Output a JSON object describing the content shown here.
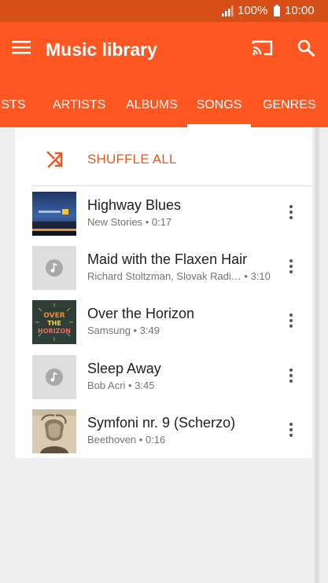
{
  "status_bar": {
    "battery_percent": "100%",
    "time": "10:00",
    "icons": [
      "signal-icon",
      "battery-icon"
    ]
  },
  "app_bar": {
    "title": "Music library",
    "icons": [
      "menu-icon",
      "cast-icon",
      "search-icon"
    ],
    "color": "#ff5722"
  },
  "tabs": [
    {
      "label": "PLAYLISTS",
      "visible": "LISTS",
      "active": false
    },
    {
      "label": "ARTISTS",
      "active": false
    },
    {
      "label": "ALBUMS",
      "active": false
    },
    {
      "label": "SONGS",
      "active": true
    },
    {
      "label": "GENRES",
      "active": false
    }
  ],
  "shuffle": {
    "label": "SHUFFLE ALL",
    "icon": "shuffle-icon",
    "color": "#e45a22"
  },
  "songs": [
    {
      "title": "Highway Blues",
      "artist": "New Stories",
      "duration": "0:17",
      "art": "highway-blues-cover"
    },
    {
      "title": "Maid with the Flaxen Hair",
      "artist": "Richard Stoltzman, Slovak Radi…",
      "duration": "3:10",
      "art": "music-note-placeholder"
    },
    {
      "title": "Over the Horizon",
      "artist": "Samsung",
      "duration": "3:49",
      "art": "over-the-horizon-cover"
    },
    {
      "title": "Sleep Away",
      "artist": "Bob Acri",
      "duration": "3:45",
      "art": "music-note-placeholder"
    },
    {
      "title": "Symfoni nr. 9 (Scherzo)",
      "artist": "Beethoven",
      "duration": "0:16",
      "art": "beethoven-cover"
    }
  ],
  "cover_art_text": {
    "over_the_horizon": [
      "OVER",
      "THE",
      "HORIZON"
    ]
  }
}
